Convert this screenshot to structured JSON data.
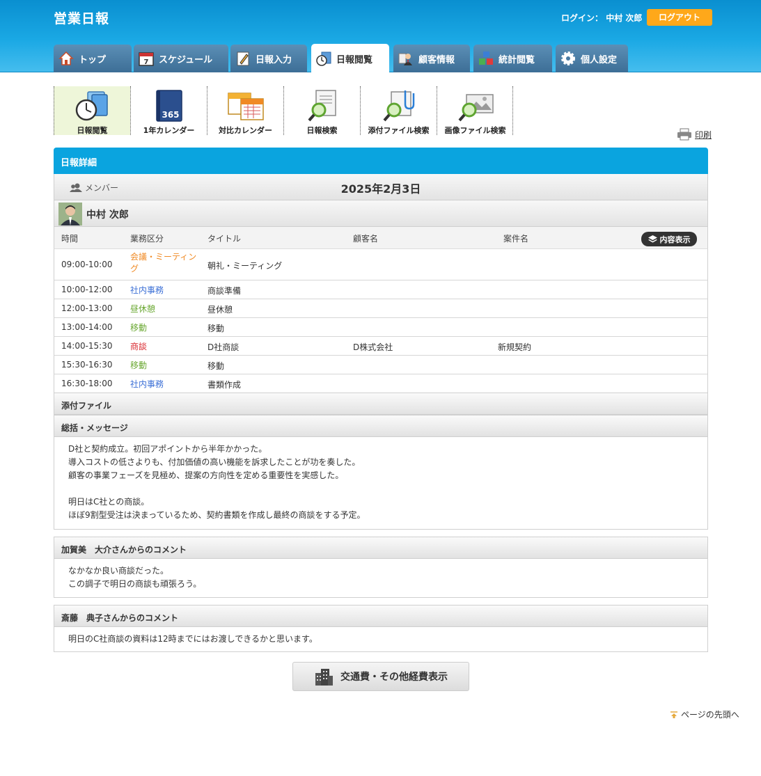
{
  "app": {
    "title": "営業日報"
  },
  "header": {
    "login_label": "ログイン：",
    "user_name": "中村 次郎",
    "logout_label": "ログアウト"
  },
  "tabs": [
    {
      "label": "トップ",
      "icon": "home-icon"
    },
    {
      "label": "スケジュール",
      "icon": "calendar-icon"
    },
    {
      "label": "日報入力",
      "icon": "pencil-icon"
    },
    {
      "label": "日報閲覧",
      "icon": "clock-folder-icon",
      "active": true
    },
    {
      "label": "顧客情報",
      "icon": "customer-icon"
    },
    {
      "label": "統計閲覧",
      "icon": "stats-blocks-icon"
    },
    {
      "label": "個人設定",
      "icon": "gear-icon"
    }
  ],
  "submenu": [
    {
      "label": "日報閲覧",
      "icon": "clock-folder-icon"
    },
    {
      "label": "1年カレンダー",
      "icon": "book-365-icon"
    },
    {
      "label": "対比カレンダー",
      "icon": "double-calendar-icon"
    },
    {
      "label": "日報検索",
      "icon": "magnifier-document-icon"
    },
    {
      "label": "添付ファイル検索",
      "icon": "magnifier-clip-icon"
    },
    {
      "label": "画像ファイル検索",
      "icon": "magnifier-image-icon"
    }
  ],
  "print_label": "印刷",
  "detail": {
    "heading": "日報詳細",
    "member_label": "メンバー",
    "date": "2025年2月3日",
    "person": "中村 次郎",
    "columns": {
      "time": "時間",
      "category": "業務区分",
      "title": "タイトル",
      "customer": "顧客名",
      "case": "案件名"
    },
    "content_button": "内容表示",
    "rows": [
      {
        "time": "09:00-10:00",
        "category": "会議・ミーティング",
        "color": "#f08a24",
        "title": "朝礼・ミーティング",
        "customer": "",
        "case": ""
      },
      {
        "time": "10:00-12:00",
        "category": "社内事務",
        "color": "#3b6fd6",
        "title": "商談準備",
        "customer": "",
        "case": ""
      },
      {
        "time": "12:00-13:00",
        "category": "昼休憩",
        "color": "#6aa832",
        "title": "昼休憩",
        "customer": "",
        "case": ""
      },
      {
        "time": "13:00-14:00",
        "category": "移動",
        "color": "#6aa832",
        "title": "移動",
        "customer": "",
        "case": ""
      },
      {
        "time": "14:00-15:30",
        "category": "商談",
        "color": "#d9262c",
        "title": "D社商談",
        "customer": "D株式会社",
        "case": "新規契約"
      },
      {
        "time": "15:30-16:30",
        "category": "移動",
        "color": "#6aa832",
        "title": "移動",
        "customer": "",
        "case": ""
      },
      {
        "time": "16:30-18:00",
        "category": "社内事務",
        "color": "#3b6fd6",
        "title": "書類作成",
        "customer": "",
        "case": ""
      }
    ],
    "attachments_label": "添付ファイル",
    "summary_label": "総括・メッセージ",
    "summary_lines": [
      "D社と契約成立。初回アポイントから半年かかった。",
      "導入コストの低さよりも、付加価値の高い機能を訴求したことが功を奏した。",
      "顧客の事業フェーズを見極め、提案の方向性を定める重要性を実感した。",
      "",
      "明日はC社との商談。",
      "ほぼ9割型受注は決まっているため、契約書類を作成し最終の商談をする予定。"
    ]
  },
  "comments": [
    {
      "heading": "加賀美　大介さんからのコメント",
      "lines": [
        "なかなか良い商談だった。",
        "この調子で明日の商談も頑張ろう。"
      ]
    },
    {
      "heading": "斎藤　典子さんからのコメント",
      "lines": [
        "明日のC社商談の資料は12時までにはお渡しできるかと思います。"
      ]
    }
  ],
  "expense_button": "交通費・その他経費表示",
  "pagetop_label": "ページの先頭へ"
}
